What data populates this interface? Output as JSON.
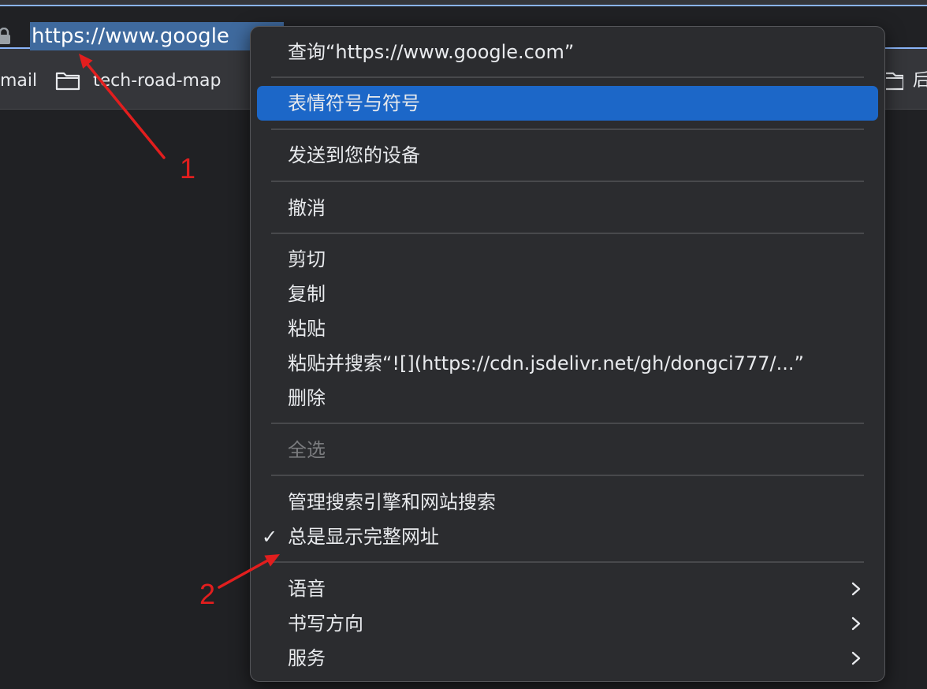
{
  "address_bar": {
    "url_text": "https://www.google",
    "lock_icon": "lock-icon"
  },
  "bookmarks_bar": {
    "items": [
      {
        "label": "mail",
        "icon": "none"
      },
      {
        "label": "tech-road-map",
        "icon": "folder-icon"
      },
      {
        "label": "后",
        "icon": "folder-icon"
      }
    ]
  },
  "context_menu": {
    "items": [
      {
        "label": "查询“https://www.google.com”"
      },
      {
        "label": "表情符号与符号",
        "highlighted": true
      },
      {
        "label": "发送到您的设备"
      },
      {
        "label": "撤消"
      },
      {
        "label": "剪切"
      },
      {
        "label": "复制"
      },
      {
        "label": "粘贴"
      },
      {
        "label": "粘贴并搜索“![](https://cdn.jsdelivr.net/gh/dongci777/...”"
      },
      {
        "label": "删除"
      },
      {
        "label": "全选",
        "disabled": true
      },
      {
        "label": "管理搜索引擎和网站搜索"
      },
      {
        "label": "总是显示完整网址",
        "checked": true,
        "check_mark": "✓"
      },
      {
        "label": "语音",
        "submenu": true
      },
      {
        "label": "书写方向",
        "submenu": true
      },
      {
        "label": "服务",
        "submenu": true
      }
    ]
  },
  "annotations": {
    "arrow_1_label": "1",
    "arrow_2_label": "2",
    "color": "#e21e1e"
  },
  "colors": {
    "highlight": "#1c67c8",
    "omnibox_border": "#8ab4f8"
  }
}
